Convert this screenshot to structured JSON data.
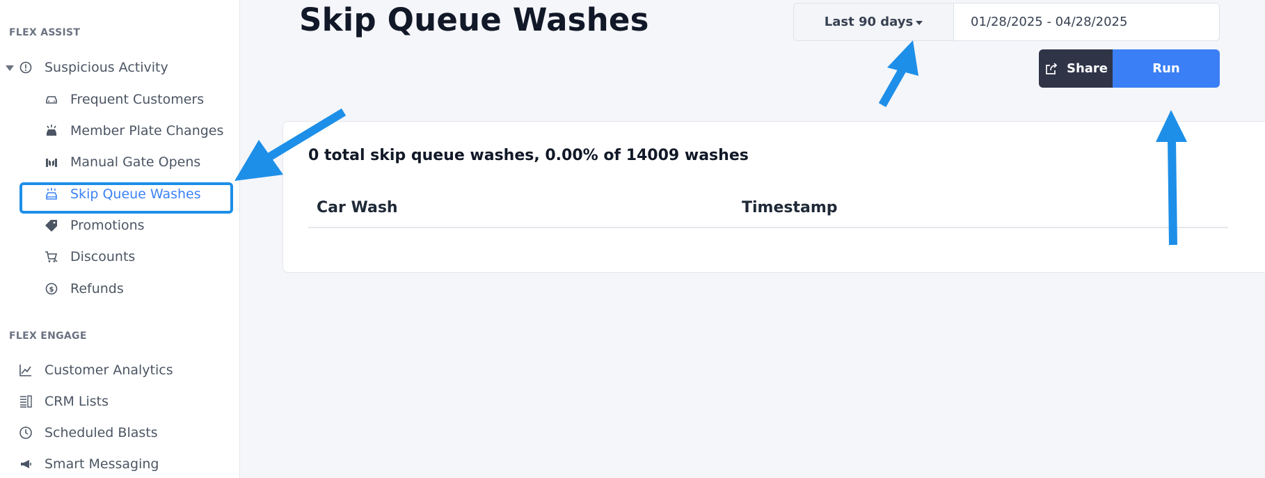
{
  "sidebar": {
    "flex_assist_label": "FLEX ASSIST",
    "suspicious_activity": "Suspicious Activity",
    "sub_items": [
      {
        "label": "Frequent Customers",
        "icon": "car-icon"
      },
      {
        "label": "Member Plate Changes",
        "icon": "car-alert-icon"
      },
      {
        "label": "Manual Gate Opens",
        "icon": "gate-icon"
      },
      {
        "label": "Skip Queue Washes",
        "icon": "car-wash-icon",
        "active": true
      },
      {
        "label": "Promotions",
        "icon": "tag-icon"
      },
      {
        "label": "Discounts",
        "icon": "cart-discount-icon"
      },
      {
        "label": "Refunds",
        "icon": "refund-icon"
      }
    ],
    "flex_engage_label": "FLEX ENGAGE",
    "engage_items": [
      {
        "label": "Customer Analytics",
        "icon": "chart-line-icon"
      },
      {
        "label": "CRM Lists",
        "icon": "list-icon"
      },
      {
        "label": "Scheduled Blasts",
        "icon": "clock-icon"
      },
      {
        "label": "Smart Messaging",
        "icon": "megaphone-icon"
      }
    ]
  },
  "header": {
    "title": "Skip Queue Washes",
    "range_select": "Last 90 days",
    "date_range": "01/28/2025 - 04/28/2025",
    "share_label": "Share",
    "run_label": "Run"
  },
  "report": {
    "summary": "0 total skip queue washes, 0.00% of 14009 washes",
    "columns": [
      "Car Wash",
      "Timestamp"
    ],
    "rows": []
  },
  "colors": {
    "accent": "#3b82f6",
    "annotation": "#1d8fe8",
    "share_bg": "#2f3447",
    "run_bg": "#3b7ff6"
  }
}
